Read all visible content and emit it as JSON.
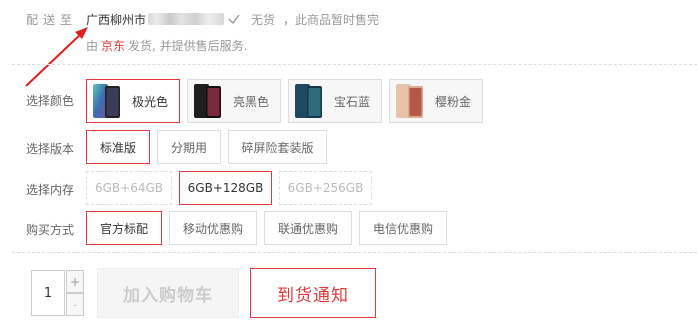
{
  "delivery": {
    "label": "配送至",
    "location": "广西柳州市",
    "stock_status": "无货",
    "stock_note": "，此商品暂时售完"
  },
  "service": {
    "prefix": "由",
    "shop": "京东",
    "suffix": "发货, 并提供售后服务."
  },
  "options": {
    "color": {
      "label": "选择颜色",
      "items": [
        {
          "name": "极光色",
          "selected": true,
          "swatch": "#3a8f8a"
        },
        {
          "name": "亮黑色",
          "selected": false,
          "swatch": "#2b2b2b"
        },
        {
          "name": "宝石蓝",
          "selected": false,
          "swatch": "#1f4f6a"
        },
        {
          "name": "樱粉金",
          "selected": false,
          "swatch": "#e6c1a8"
        }
      ]
    },
    "version": {
      "label": "选择版本",
      "items": [
        {
          "name": "标准版",
          "selected": true
        },
        {
          "name": "分期用",
          "selected": false
        },
        {
          "name": "碎屏险套装版",
          "selected": false
        }
      ]
    },
    "memory": {
      "label": "选择内存",
      "items": [
        {
          "name": "6GB+64GB",
          "selected": false
        },
        {
          "name": "6GB+128GB",
          "selected": true
        },
        {
          "name": "6GB+256GB",
          "selected": false
        }
      ]
    },
    "purchase": {
      "label": "购买方式",
      "items": [
        {
          "name": "官方标配",
          "selected": true
        },
        {
          "name": "移动优惠购",
          "selected": false
        },
        {
          "name": "联通优惠购",
          "selected": false
        },
        {
          "name": "电信优惠购",
          "selected": false
        }
      ]
    }
  },
  "cart": {
    "quantity": "1",
    "plus": "+",
    "minus": "-",
    "add_to_cart": "加入购物车",
    "notify": "到货通知"
  },
  "colors": {
    "accent": "#e4393c",
    "border": "#dddddd"
  }
}
